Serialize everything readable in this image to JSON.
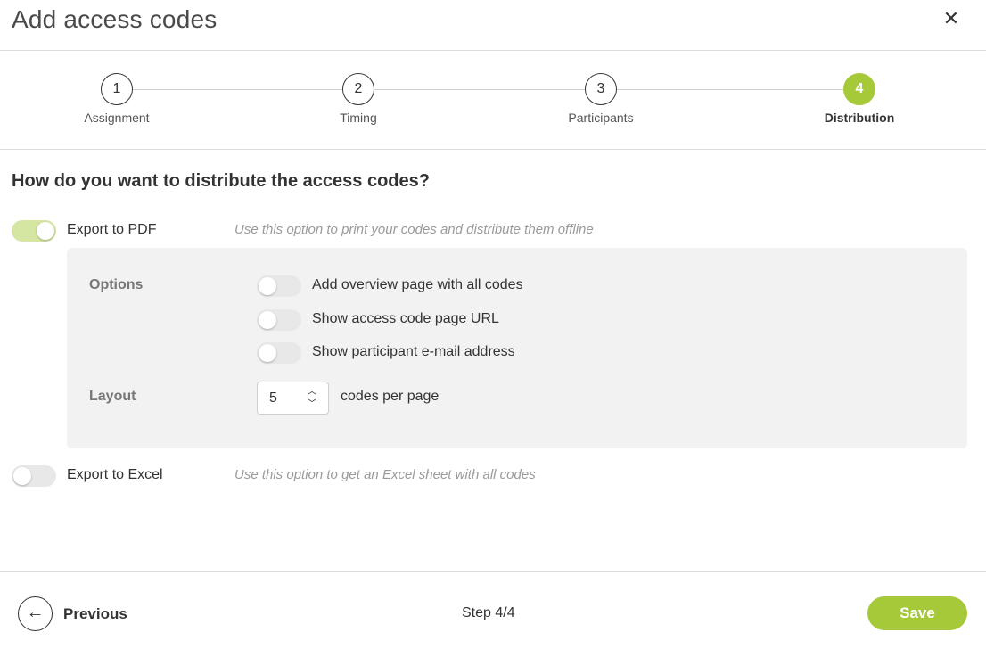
{
  "header": {
    "title": "Add access codes",
    "close_icon": "close-icon"
  },
  "stepper": {
    "steps": [
      {
        "number": "1",
        "label": "Assignment",
        "active": false
      },
      {
        "number": "2",
        "label": "Timing",
        "active": false
      },
      {
        "number": "3",
        "label": "Participants",
        "active": false
      },
      {
        "number": "4",
        "label": "Distribution",
        "active": true
      }
    ],
    "accent_color": "#a6c93a"
  },
  "main": {
    "question": "How do you want to distribute the access codes?",
    "pdf": {
      "label": "Export to PDF",
      "hint": "Use this option to print your codes and distribute them offline",
      "enabled": true,
      "options_heading": "Options",
      "options": [
        {
          "label": "Add overview page with all codes",
          "enabled": false
        },
        {
          "label": "Show access code page URL",
          "enabled": false
        },
        {
          "label": "Show participant e-mail address",
          "enabled": false
        }
      ],
      "layout_heading": "Layout",
      "codes_per_page_value": "5",
      "codes_per_page_label": "codes per page"
    },
    "excel": {
      "label": "Export to Excel",
      "hint": "Use this option to get an Excel sheet with all codes",
      "enabled": false
    }
  },
  "footer": {
    "previous_label": "Previous",
    "step_indicator": "Step 4/4",
    "save_label": "Save"
  }
}
